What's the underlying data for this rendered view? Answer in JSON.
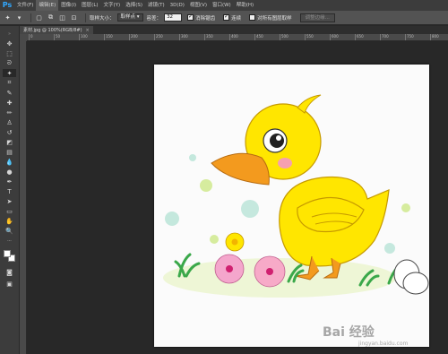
{
  "app": {
    "logo": "Ps"
  },
  "menu": [
    {
      "label": "文件(F)"
    },
    {
      "label": "编辑(E)",
      "active": true
    },
    {
      "label": "图像(I)"
    },
    {
      "label": "图层(L)"
    },
    {
      "label": "文字(Y)"
    },
    {
      "label": "选择(S)"
    },
    {
      "label": "滤镜(T)"
    },
    {
      "label": "3D(D)"
    },
    {
      "label": "视图(V)"
    },
    {
      "label": "窗口(W)"
    },
    {
      "label": "帮助(H)"
    }
  ],
  "options": {
    "sample_size_label": "取样大小：",
    "sample_size_value": "取样点",
    "tolerance_label": "容差：",
    "tolerance_value": "32",
    "antialias_label": "消除锯齿",
    "contiguous_label": "连续",
    "sample_all_label": "对所有图层取样",
    "refine_edge_label": "调整边缘..."
  },
  "document": {
    "tab_title": "素材.jpg @ 100%(RGB/8#)",
    "close": "×"
  },
  "ruler": {
    "ticks": [
      "0",
      "50",
      "100",
      "150",
      "200",
      "250",
      "300",
      "350",
      "400",
      "450",
      "500",
      "550",
      "600",
      "650",
      "700",
      "750",
      "800"
    ]
  },
  "watermark": {
    "brand": "Bai 经验",
    "url": "jingyan.baidu.com"
  },
  "colors": {
    "accent": "#31a8ff",
    "duck_body": "#ffe600",
    "beak": "#f39a1e",
    "grass": "#3aa84a"
  }
}
